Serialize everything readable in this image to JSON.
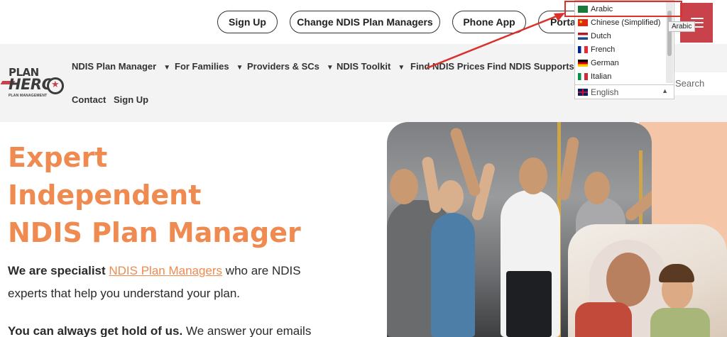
{
  "topbar": {
    "signup_label": "Sign Up",
    "change_label": "Change NDIS Plan Managers",
    "phoneapp_label": "Phone App",
    "portal_label": "Portal"
  },
  "logo": {
    "line1": "PLAN",
    "line2": "HERO",
    "tagline": "PLAN MANAGEMENT"
  },
  "nav": {
    "items": [
      {
        "label": "NDIS Plan Manager"
      },
      {
        "label": "For Families"
      },
      {
        "label": "Providers & SCs"
      },
      {
        "label": "NDIS Toolkit"
      },
      {
        "label": "Find NDIS Prices"
      },
      {
        "label": "Find NDIS Supports"
      },
      {
        "label": "Contact"
      },
      {
        "label": "Sign Up"
      }
    ],
    "search_placeholder": "Search"
  },
  "language_menu": {
    "options": [
      {
        "label": "Arabic",
        "flag": "saudi-flag"
      },
      {
        "label": "Chinese (Simplified)",
        "flag": "china-flag"
      },
      {
        "label": "Dutch",
        "flag": "netherlands-flag"
      },
      {
        "label": "French",
        "flag": "france-flag"
      },
      {
        "label": "German",
        "flag": "germany-flag"
      },
      {
        "label": "Italian",
        "flag": "italy-flag"
      }
    ],
    "selected": "English",
    "tooltip": "Arabic"
  },
  "hero": {
    "title_line1": "Expert",
    "title_line2": "Independent",
    "title_line3": "NDIS Plan Manager",
    "para1_prefix": "We are specialist ",
    "para1_link": "NDIS Plan Managers",
    "para1_suffix": " who are NDIS",
    "para1_line2": "experts that help you understand your plan.",
    "para2_bold": "You can always get hold of us.",
    "para2_rest": " We answer your emails"
  },
  "colors": {
    "accent_orange": "#ef8a50",
    "brand_red": "#c8414b",
    "annotation_red": "#d9322c",
    "nav_bg": "#f4f3f3"
  }
}
